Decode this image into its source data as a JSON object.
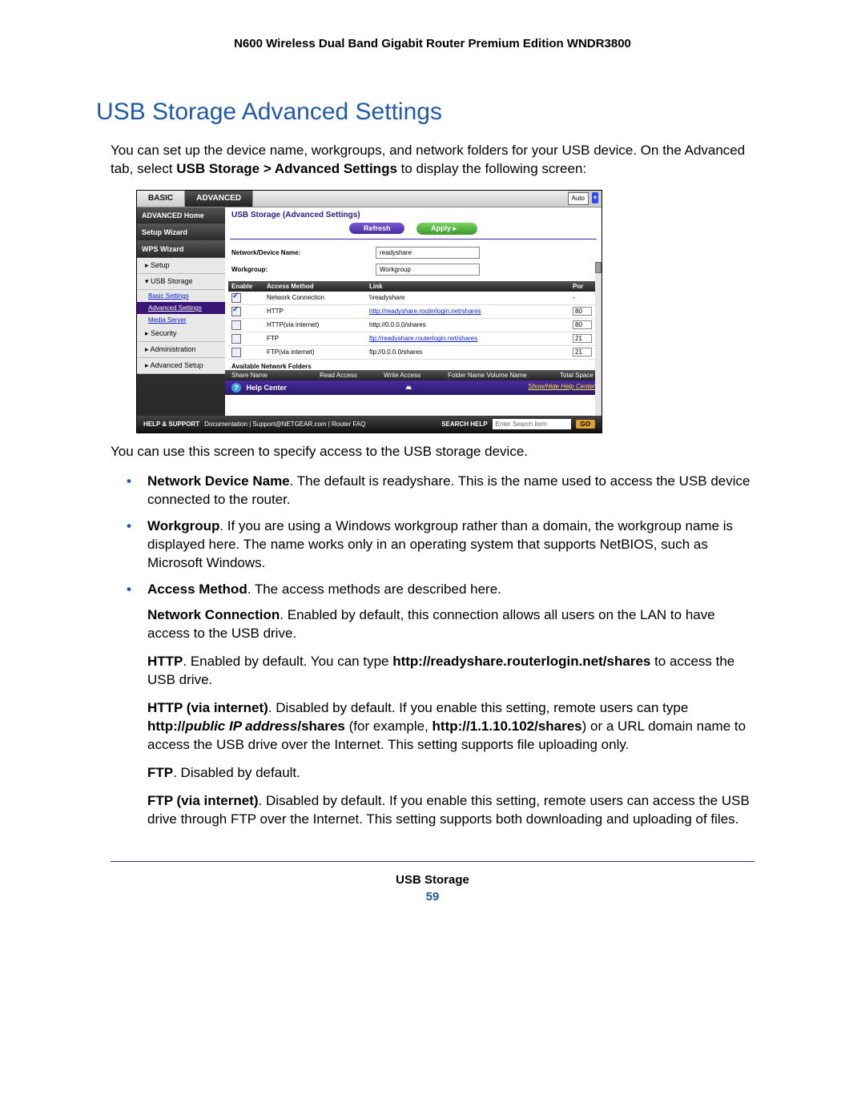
{
  "doc_header": "N600 Wireless Dual Band Gigabit Router Premium Edition WNDR3800",
  "section_title": "USB Storage Advanced Settings",
  "intro_text_1": "You can set up the device name, workgroups, and network folders for your USB device. On the Advanced tab, select ",
  "intro_bold_path": "USB Storage > Advanced Settings",
  "intro_text_2": " to display the following screen:",
  "screenshot": {
    "tabs": {
      "basic": "BASIC",
      "advanced": "ADVANCED"
    },
    "auto_label": "Auto",
    "sidebar": {
      "adv_home": "ADVANCED Home",
      "setup_wizard": "Setup Wizard",
      "wps_wizard": "WPS Wizard",
      "setup": "▸ Setup",
      "usb_storage": "▾ USB Storage",
      "basic_settings": "Basic Settings",
      "advanced_settings": "Advanced Settings",
      "media_server": "Media Server",
      "security": "▸ Security",
      "administration": "▸ Administration",
      "advanced_setup": "▸ Advanced Setup"
    },
    "content_title": "USB Storage (Advanced Settings)",
    "refresh": "Refresh",
    "apply": "Apply    ▸",
    "device_name_label": "Network/Device Name:",
    "device_name_value": "readyshare",
    "workgroup_label": "Workgroup:",
    "workgroup_value": "Workgroup",
    "table_headers": {
      "enable": "Enable",
      "method": "Access Method",
      "link": "Link",
      "port": "Por"
    },
    "rows": [
      {
        "chk": true,
        "method": "Network Connection",
        "link": "\\\\readyshare",
        "link_is_url": false,
        "port": "-"
      },
      {
        "chk": true,
        "method": "HTTP",
        "link": "http://readyshare.routerlogin.net/shares",
        "link_is_url": true,
        "port": "80"
      },
      {
        "chk": false,
        "method": "HTTP(via internet)",
        "link": "http://0.0.0.0/shares",
        "link_is_url": false,
        "port": "80"
      },
      {
        "chk": false,
        "method": "FTP",
        "link": "ftp://readyshare.routerlogin.net/shares",
        "link_is_url": true,
        "port": "21"
      },
      {
        "chk": false,
        "method": "FTP(via internet)",
        "link": "ftp://0.0.0.0/shares",
        "link_is_url": false,
        "port": "21"
      }
    ],
    "avail_folders": "Available Network Folders",
    "folder_headers": {
      "share": "Share Name",
      "read": "Read Access",
      "write": "Write Access",
      "folder": "Folder Name Volume Name",
      "total": "Total Space"
    },
    "help_center": "Help Center",
    "show_hide": "Show/Hide Help Center",
    "footer": {
      "help_support": "HELP & SUPPORT",
      "links": "Documentation | Support@NETGEAR.com | Router FAQ",
      "search_help": "SEARCH HELP",
      "search_placeholder": "Enter Search Item",
      "go": "GO"
    }
  },
  "after_ss_text": "You can use this screen to specify access to the USB storage device.",
  "bullets": {
    "b1_bold": "Network Device Name",
    "b1_text": ". The default is readyshare. This is the name used to access the USB device connected to the router.",
    "b2_bold": "Workgroup",
    "b2_text": ". If you are using a Windows workgroup rather than a domain, the workgroup name is displayed here. The name works only in an operating system that supports NetBIOS, such as Microsoft Windows.",
    "b3_bold": "Access Method",
    "b3_text": ". The access methods are described here."
  },
  "subs": {
    "s1_bold": "Network Connection",
    "s1_text": ". Enabled by default, this connection allows all users on the LAN to have access to the USB drive.",
    "s2_bold": "HTTP",
    "s2_text_a": ". Enabled by default. You can type ",
    "s2_url": "http://readyshare.routerlogin.net/shares",
    "s2_text_b": " to access the USB drive.",
    "s3_bold": "HTTP (via internet)",
    "s3_text_a": ". Disabled by default. If you enable this setting, remote users can type ",
    "s3_prefix": "http://",
    "s3_italic": "public IP address",
    "s3_suffix": "/shares",
    "s3_text_b": " (for example, ",
    "s3_example": "http://1.1.10.102/shares",
    "s3_text_c": ") or a URL domain name to access the USB drive over the Internet. This setting supports file uploading only.",
    "s4_bold": "FTP",
    "s4_text": ". Disabled by default.",
    "s5_bold": "FTP (via internet)",
    "s5_text": ". Disabled by default. If you enable this setting, remote users can access the USB drive through FTP over the Internet. This setting supports both downloading and uploading of files."
  },
  "page_foot_label": "USB Storage",
  "page_number": "59"
}
